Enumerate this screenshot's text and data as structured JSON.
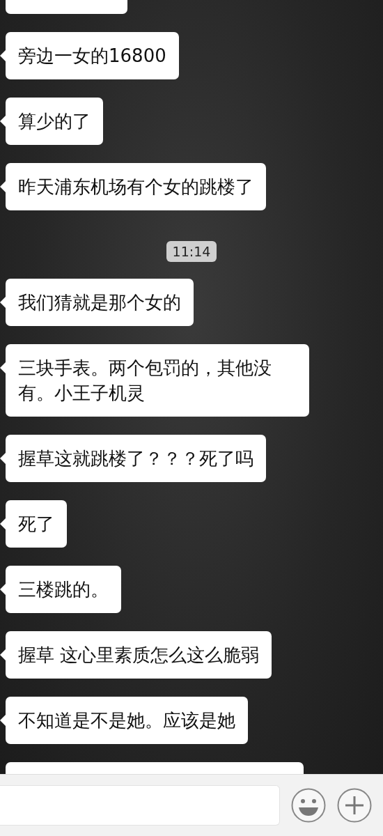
{
  "messages": [
    {
      "kind": "cut_top"
    },
    {
      "kind": "text",
      "text": "旁边一女的16800"
    },
    {
      "kind": "text",
      "text": "算少的了"
    },
    {
      "kind": "text",
      "text": "昨天浦东机场有个女的跳楼了"
    },
    {
      "kind": "time",
      "text": "11:14"
    },
    {
      "kind": "text",
      "text": "我们猜就是那个女的"
    },
    {
      "kind": "text",
      "text": "三块手表。两个包罚的，其他没有。小王子机灵"
    },
    {
      "kind": "text",
      "text": "握草这就跳楼了？？？死了吗"
    },
    {
      "kind": "text",
      "text": "死了"
    },
    {
      "kind": "text",
      "text": "三楼跳的。"
    },
    {
      "kind": "text",
      "text": "握草 这心里素质怎么这么脆弱"
    },
    {
      "kind": "text",
      "text": "不知道是不是她。应该是她"
    },
    {
      "kind": "cut_bottom"
    }
  ]
}
